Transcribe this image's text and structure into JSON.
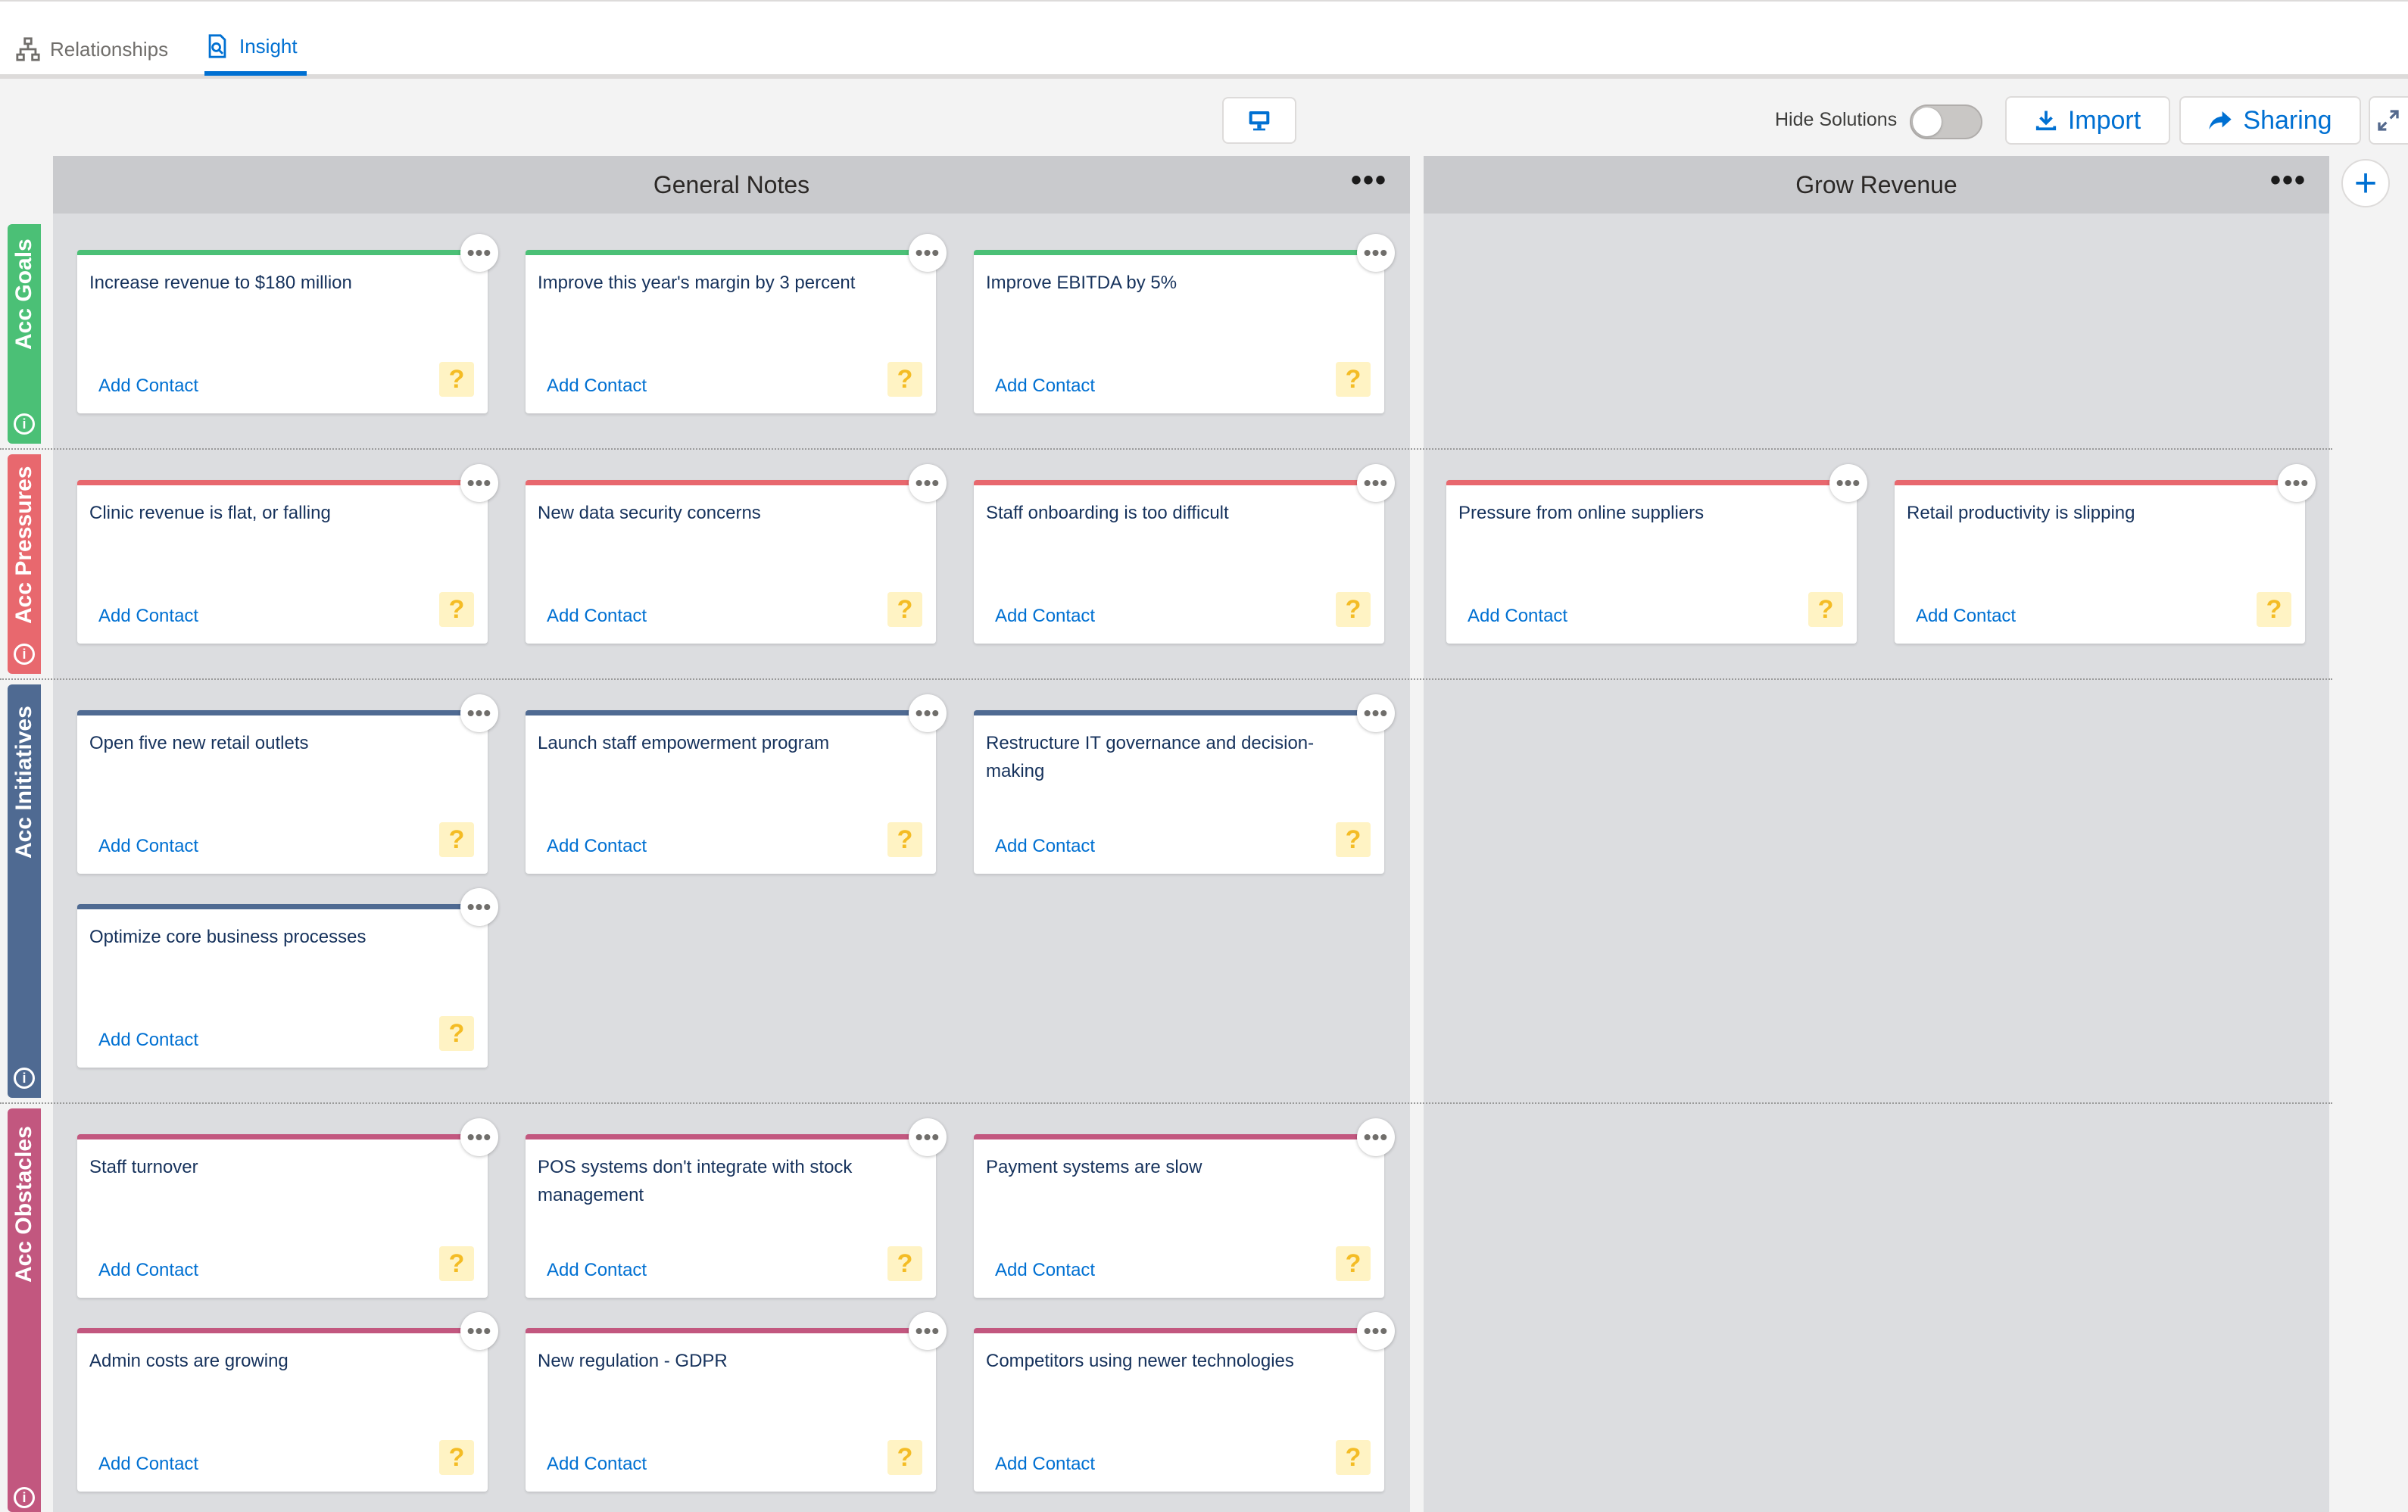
{
  "tabs": [
    {
      "label": "Relationships",
      "active": false
    },
    {
      "label": "Insight",
      "active": true
    }
  ],
  "toolbar": {
    "hide_solutions_label": "Hide Solutions",
    "hide_solutions_on": false,
    "import_label": "Import",
    "sharing_label": "Sharing"
  },
  "columns": [
    {
      "title": "General Notes",
      "menu": "•••"
    },
    {
      "title": "Grow Revenue",
      "menu": "•••"
    }
  ],
  "lanes": [
    {
      "label": "Acc Goals",
      "color": "#4bc076"
    },
    {
      "label": "Acc Pressures",
      "color": "#e8686e"
    },
    {
      "label": "Acc Initiatives",
      "color": "#4f6a92"
    },
    {
      "label": "Acc Obstacles",
      "color": "#c2577f"
    }
  ],
  "card_common": {
    "add_contact": "Add Contact",
    "help": "?",
    "menu": "•••"
  },
  "cards": {
    "goals": [
      "Increase revenue to $180 million",
      "Improve this year's margin by 3 percent",
      "Improve EBITDA by 5%"
    ],
    "pressures_general": [
      "Clinic revenue is flat, or falling",
      "New data security concerns",
      "Staff onboarding is too difficult"
    ],
    "pressures_grow": [
      "Pressure from online suppliers",
      "Retail productivity is slipping"
    ],
    "initiatives": [
      "Open five new retail outlets",
      "Launch staff empowerment program",
      "Restructure IT governance and decision-making",
      "Optimize core business processes"
    ],
    "obstacles": [
      "Staff turnover",
      "POS systems don't integrate with stock management",
      "Payment systems are slow",
      "Admin costs are growing",
      "New regulation - GDPR",
      "Competitors using newer technologies"
    ]
  },
  "icons": [
    "hierarchy-icon",
    "insight-icon",
    "presentation-icon",
    "download-icon",
    "share-icon",
    "expand-icon",
    "plus-icon",
    "info-icon",
    "question-icon"
  ]
}
